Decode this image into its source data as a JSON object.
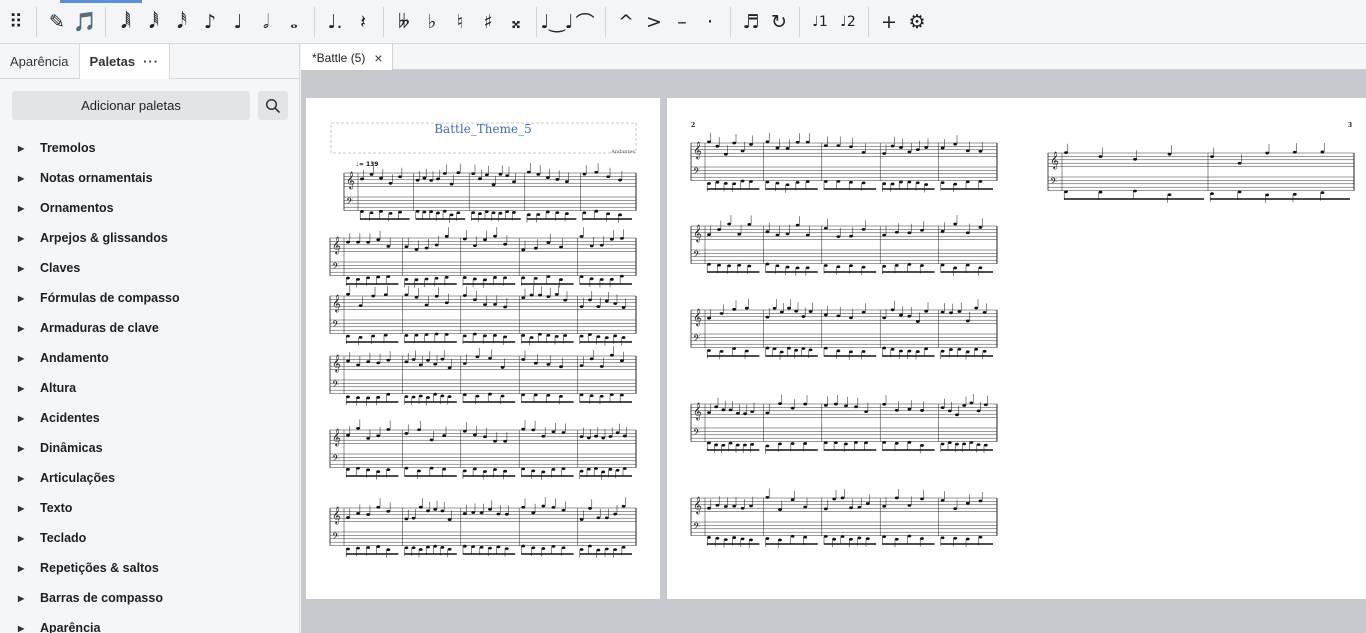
{
  "toolbar": {
    "items": [
      {
        "name": "drag-handle-icon",
        "glyph": "⠿"
      },
      {
        "name": "pencil-input-icon",
        "glyph": "✎"
      },
      {
        "name": "note-input-mode-icon",
        "glyph": "🎵"
      },
      {
        "name": "sixty-fourth-note-icon",
        "glyph": "𝅘𝅥𝅲"
      },
      {
        "name": "thirty-second-note-icon",
        "glyph": "𝅘𝅥𝅱"
      },
      {
        "name": "sixteenth-note-icon",
        "glyph": "𝅘𝅥𝅰"
      },
      {
        "name": "eighth-note-icon",
        "glyph": "♪"
      },
      {
        "name": "quarter-note-icon",
        "glyph": "♩"
      },
      {
        "name": "half-note-icon",
        "glyph": "𝅗𝅥"
      },
      {
        "name": "whole-note-icon",
        "glyph": "𝅝"
      },
      {
        "name": "augmentation-dot-icon",
        "glyph": "♩."
      },
      {
        "name": "rest-icon",
        "glyph": "𝄽"
      },
      {
        "name": "double-flat-icon",
        "glyph": "𝄫"
      },
      {
        "name": "flat-icon",
        "glyph": "♭"
      },
      {
        "name": "natural-icon",
        "glyph": "♮"
      },
      {
        "name": "sharp-icon",
        "glyph": "♯"
      },
      {
        "name": "double-sharp-icon",
        "glyph": "𝄪"
      },
      {
        "name": "tie-icon",
        "glyph": "♩‿♩"
      },
      {
        "name": "slur-icon",
        "glyph": "⌒"
      },
      {
        "name": "marcato-icon",
        "glyph": "^"
      },
      {
        "name": "accent-icon",
        "glyph": ">"
      },
      {
        "name": "tenuto-icon",
        "glyph": "–"
      },
      {
        "name": "staccato-icon",
        "glyph": "·"
      },
      {
        "name": "tuplet-icon",
        "glyph": "♬"
      },
      {
        "name": "flip-direction-icon",
        "glyph": "↻"
      },
      {
        "name": "voice-1-icon",
        "glyph": "♩1"
      },
      {
        "name": "voice-2-icon",
        "glyph": "♩2"
      },
      {
        "name": "add-icon",
        "glyph": "+"
      },
      {
        "name": "gear-icon",
        "glyph": "⚙"
      }
    ]
  },
  "panel": {
    "tab_appearance": "Aparência",
    "tab_palettes": "Paletas",
    "tab_more": "···",
    "add_palettes": "Adicionar paletas",
    "palettes": [
      "Tremolos",
      "Notas ornamentais",
      "Ornamentos",
      "Arpejos & glissandos",
      "Claves",
      "Fórmulas de compasso",
      "Armaduras de clave",
      "Andamento",
      "Altura",
      "Acidentes",
      "Dinâmicas",
      "Articulações",
      "Texto",
      "Teclado",
      "Repetições & saltos",
      "Barras de compasso",
      "Aparência"
    ]
  },
  "document": {
    "tab_title": "*Battle (5)",
    "tab_close": "×"
  },
  "score": {
    "title": "Battle_Theme_5",
    "composer": "Andantes",
    "tempo": "♩= 139",
    "page_numbers": [
      "2",
      "3"
    ],
    "colors": {
      "title": "#3e6db3",
      "frame": "#c9c9c9"
    }
  }
}
